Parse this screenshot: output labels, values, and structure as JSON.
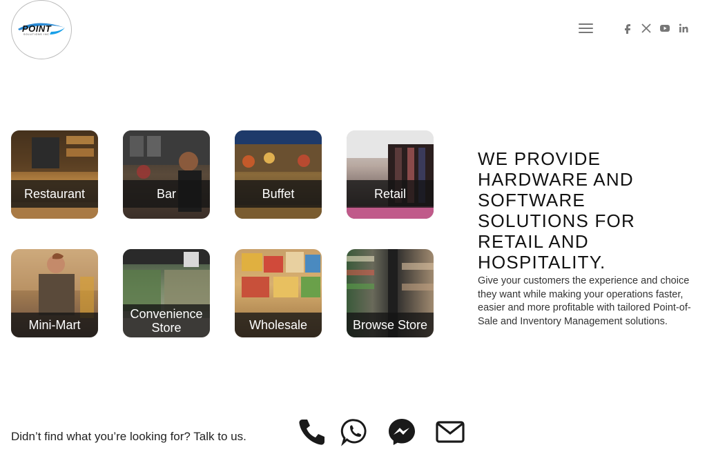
{
  "brand": {
    "logo_text": "POINT",
    "logo_subtext": "SOLUTIONS INC"
  },
  "header": {
    "menu_icon": "hamburger-icon",
    "social": [
      {
        "name": "facebook-icon"
      },
      {
        "name": "x-icon"
      },
      {
        "name": "youtube-icon"
      },
      {
        "name": "linkedin-icon"
      }
    ]
  },
  "tiles": [
    {
      "label": "Restaurant"
    },
    {
      "label": "Bar"
    },
    {
      "label": "Buffet"
    },
    {
      "label": "Retail"
    },
    {
      "label": "Mini-Mart"
    },
    {
      "label": "Convenience Store"
    },
    {
      "label": "Wholesale"
    },
    {
      "label": "Browse Store"
    }
  ],
  "hero": {
    "headline": "WE PROVIDE HARDWARE AND SOFTWARE SOLUTIONS FOR RETAIL AND HOSPITALITY.",
    "description": "Give your customers the experience and choice they want while making your operations faster, easier and more profitable with tailored Point-of-Sale and Inventory Management solutions."
  },
  "footer": {
    "prompt": "Didn’t find what you’re looking for? Talk to us.",
    "contacts": [
      {
        "name": "phone-icon"
      },
      {
        "name": "whatsapp-icon"
      },
      {
        "name": "messenger-icon"
      },
      {
        "name": "email-icon"
      }
    ]
  },
  "colors": {
    "band": "#141414",
    "icon_gray": "#777777",
    "contact_icon": "#1a1a1a"
  }
}
